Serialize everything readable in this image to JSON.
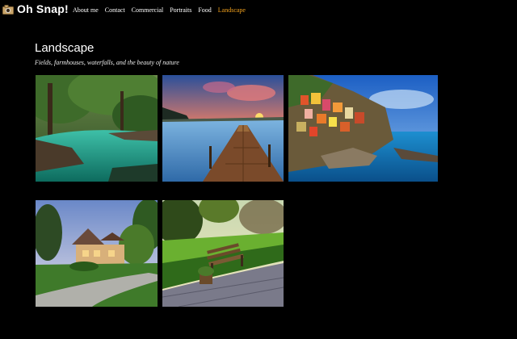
{
  "header": {
    "brand": "Oh Snap!",
    "nav": [
      {
        "label": "About me",
        "active": false
      },
      {
        "label": "Contact",
        "active": false
      },
      {
        "label": "Commercial",
        "active": false
      },
      {
        "label": "Portraits",
        "active": false
      },
      {
        "label": "Food",
        "active": false
      },
      {
        "label": "Landscape",
        "active": true
      }
    ],
    "active_color": "#f3a21d"
  },
  "section": {
    "title": "Landscape",
    "subtitle": "Fields, farmhouses, waterfalls, and the beauty of nature"
  },
  "gallery": {
    "photos": [
      {
        "subject": "forest-river"
      },
      {
        "subject": "lake-pier-sunset"
      },
      {
        "subject": "cliffside-village-sea"
      },
      {
        "subject": "house-with-driveway"
      },
      {
        "subject": "garden-bench-path"
      }
    ]
  }
}
